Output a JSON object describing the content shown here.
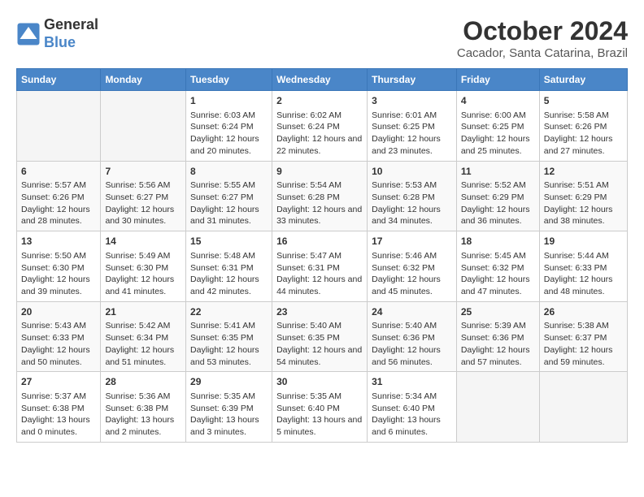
{
  "header": {
    "logo_line1": "General",
    "logo_line2": "Blue",
    "title": "October 2024",
    "subtitle": "Cacador, Santa Catarina, Brazil"
  },
  "days_of_week": [
    "Sunday",
    "Monday",
    "Tuesday",
    "Wednesday",
    "Thursday",
    "Friday",
    "Saturday"
  ],
  "weeks": [
    [
      {
        "day": "",
        "content": ""
      },
      {
        "day": "",
        "content": ""
      },
      {
        "day": "1",
        "sunrise": "Sunrise: 6:03 AM",
        "sunset": "Sunset: 6:24 PM",
        "daylight": "Daylight: 12 hours and 20 minutes."
      },
      {
        "day": "2",
        "sunrise": "Sunrise: 6:02 AM",
        "sunset": "Sunset: 6:24 PM",
        "daylight": "Daylight: 12 hours and 22 minutes."
      },
      {
        "day": "3",
        "sunrise": "Sunrise: 6:01 AM",
        "sunset": "Sunset: 6:25 PM",
        "daylight": "Daylight: 12 hours and 23 minutes."
      },
      {
        "day": "4",
        "sunrise": "Sunrise: 6:00 AM",
        "sunset": "Sunset: 6:25 PM",
        "daylight": "Daylight: 12 hours and 25 minutes."
      },
      {
        "day": "5",
        "sunrise": "Sunrise: 5:58 AM",
        "sunset": "Sunset: 6:26 PM",
        "daylight": "Daylight: 12 hours and 27 minutes."
      }
    ],
    [
      {
        "day": "6",
        "sunrise": "Sunrise: 5:57 AM",
        "sunset": "Sunset: 6:26 PM",
        "daylight": "Daylight: 12 hours and 28 minutes."
      },
      {
        "day": "7",
        "sunrise": "Sunrise: 5:56 AM",
        "sunset": "Sunset: 6:27 PM",
        "daylight": "Daylight: 12 hours and 30 minutes."
      },
      {
        "day": "8",
        "sunrise": "Sunrise: 5:55 AM",
        "sunset": "Sunset: 6:27 PM",
        "daylight": "Daylight: 12 hours and 31 minutes."
      },
      {
        "day": "9",
        "sunrise": "Sunrise: 5:54 AM",
        "sunset": "Sunset: 6:28 PM",
        "daylight": "Daylight: 12 hours and 33 minutes."
      },
      {
        "day": "10",
        "sunrise": "Sunrise: 5:53 AM",
        "sunset": "Sunset: 6:28 PM",
        "daylight": "Daylight: 12 hours and 34 minutes."
      },
      {
        "day": "11",
        "sunrise": "Sunrise: 5:52 AM",
        "sunset": "Sunset: 6:29 PM",
        "daylight": "Daylight: 12 hours and 36 minutes."
      },
      {
        "day": "12",
        "sunrise": "Sunrise: 5:51 AM",
        "sunset": "Sunset: 6:29 PM",
        "daylight": "Daylight: 12 hours and 38 minutes."
      }
    ],
    [
      {
        "day": "13",
        "sunrise": "Sunrise: 5:50 AM",
        "sunset": "Sunset: 6:30 PM",
        "daylight": "Daylight: 12 hours and 39 minutes."
      },
      {
        "day": "14",
        "sunrise": "Sunrise: 5:49 AM",
        "sunset": "Sunset: 6:30 PM",
        "daylight": "Daylight: 12 hours and 41 minutes."
      },
      {
        "day": "15",
        "sunrise": "Sunrise: 5:48 AM",
        "sunset": "Sunset: 6:31 PM",
        "daylight": "Daylight: 12 hours and 42 minutes."
      },
      {
        "day": "16",
        "sunrise": "Sunrise: 5:47 AM",
        "sunset": "Sunset: 6:31 PM",
        "daylight": "Daylight: 12 hours and 44 minutes."
      },
      {
        "day": "17",
        "sunrise": "Sunrise: 5:46 AM",
        "sunset": "Sunset: 6:32 PM",
        "daylight": "Daylight: 12 hours and 45 minutes."
      },
      {
        "day": "18",
        "sunrise": "Sunrise: 5:45 AM",
        "sunset": "Sunset: 6:32 PM",
        "daylight": "Daylight: 12 hours and 47 minutes."
      },
      {
        "day": "19",
        "sunrise": "Sunrise: 5:44 AM",
        "sunset": "Sunset: 6:33 PM",
        "daylight": "Daylight: 12 hours and 48 minutes."
      }
    ],
    [
      {
        "day": "20",
        "sunrise": "Sunrise: 5:43 AM",
        "sunset": "Sunset: 6:33 PM",
        "daylight": "Daylight: 12 hours and 50 minutes."
      },
      {
        "day": "21",
        "sunrise": "Sunrise: 5:42 AM",
        "sunset": "Sunset: 6:34 PM",
        "daylight": "Daylight: 12 hours and 51 minutes."
      },
      {
        "day": "22",
        "sunrise": "Sunrise: 5:41 AM",
        "sunset": "Sunset: 6:35 PM",
        "daylight": "Daylight: 12 hours and 53 minutes."
      },
      {
        "day": "23",
        "sunrise": "Sunrise: 5:40 AM",
        "sunset": "Sunset: 6:35 PM",
        "daylight": "Daylight: 12 hours and 54 minutes."
      },
      {
        "day": "24",
        "sunrise": "Sunrise: 5:40 AM",
        "sunset": "Sunset: 6:36 PM",
        "daylight": "Daylight: 12 hours and 56 minutes."
      },
      {
        "day": "25",
        "sunrise": "Sunrise: 5:39 AM",
        "sunset": "Sunset: 6:36 PM",
        "daylight": "Daylight: 12 hours and 57 minutes."
      },
      {
        "day": "26",
        "sunrise": "Sunrise: 5:38 AM",
        "sunset": "Sunset: 6:37 PM",
        "daylight": "Daylight: 12 hours and 59 minutes."
      }
    ],
    [
      {
        "day": "27",
        "sunrise": "Sunrise: 5:37 AM",
        "sunset": "Sunset: 6:38 PM",
        "daylight": "Daylight: 13 hours and 0 minutes."
      },
      {
        "day": "28",
        "sunrise": "Sunrise: 5:36 AM",
        "sunset": "Sunset: 6:38 PM",
        "daylight": "Daylight: 13 hours and 2 minutes."
      },
      {
        "day": "29",
        "sunrise": "Sunrise: 5:35 AM",
        "sunset": "Sunset: 6:39 PM",
        "daylight": "Daylight: 13 hours and 3 minutes."
      },
      {
        "day": "30",
        "sunrise": "Sunrise: 5:35 AM",
        "sunset": "Sunset: 6:40 PM",
        "daylight": "Daylight: 13 hours and 5 minutes."
      },
      {
        "day": "31",
        "sunrise": "Sunrise: 5:34 AM",
        "sunset": "Sunset: 6:40 PM",
        "daylight": "Daylight: 13 hours and 6 minutes."
      },
      {
        "day": "",
        "content": ""
      },
      {
        "day": "",
        "content": ""
      }
    ]
  ]
}
